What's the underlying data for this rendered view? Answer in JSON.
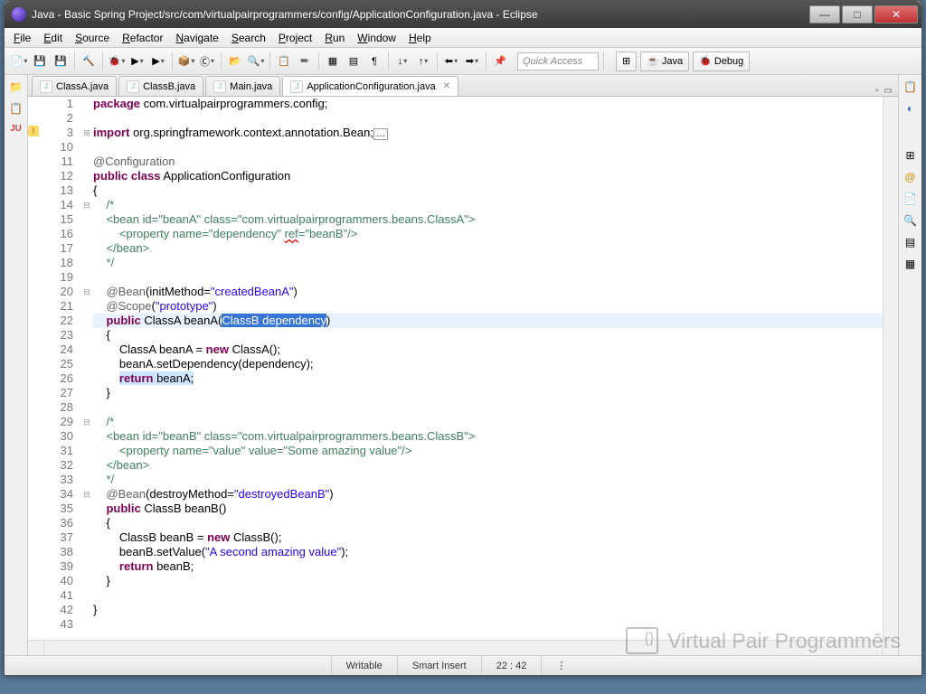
{
  "window": {
    "title": "Java - Basic Spring Project/src/com/virtualpairprogrammers/config/ApplicationConfiguration.java - Eclipse"
  },
  "menu": {
    "items": [
      "File",
      "Edit",
      "Source",
      "Refactor",
      "Navigate",
      "Search",
      "Project",
      "Run",
      "Window",
      "Help"
    ]
  },
  "toolbar": {
    "quick_access": "Quick Access",
    "perspectives": [
      {
        "label": "Java",
        "icon": "☕"
      },
      {
        "label": "Debug",
        "icon": "🐞"
      }
    ]
  },
  "tabs": [
    {
      "label": "ClassA.java",
      "active": false
    },
    {
      "label": "ClassB.java",
      "active": false
    },
    {
      "label": "Main.java",
      "active": false
    },
    {
      "label": "ApplicationConfiguration.java",
      "active": true
    }
  ],
  "code": {
    "lines": [
      {
        "n": 1,
        "html": "<span class='kw'>package</span> com.virtualpairprogrammers.config;"
      },
      {
        "n": 2,
        "html": ""
      },
      {
        "n": 3,
        "html": "<span class='kw'>import</span> org.springframework.context.annotation.Bean;<span style='border:1px solid #999;padding:0 2px;font-size:10px;'>…</span>",
        "fold": "+",
        "warn": true
      },
      {
        "n": 10,
        "html": ""
      },
      {
        "n": 11,
        "html": "<span class='ann'>@Configuration</span>"
      },
      {
        "n": 12,
        "html": "<span class='kw'>public</span> <span class='kw'>class</span> ApplicationConfiguration"
      },
      {
        "n": 13,
        "html": "{"
      },
      {
        "n": 14,
        "html": "    <span class='com'>/*</span>",
        "fold": "-"
      },
      {
        "n": 15,
        "html": "    <span class='com'>&lt;bean id=\"beanA\" class=\"com.virtualpairprogrammers.beans.ClassA\"&gt;</span>"
      },
      {
        "n": 16,
        "html": "        <span class='com'>&lt;property name=\"dependency\" <span style='text-decoration:underline wavy red;'>ref</span>=\"beanB\"/&gt;</span>"
      },
      {
        "n": 17,
        "html": "    <span class='com'>&lt;/bean&gt;</span>"
      },
      {
        "n": 18,
        "html": "    <span class='com'>*/</span>"
      },
      {
        "n": 19,
        "html": ""
      },
      {
        "n": 20,
        "html": "    <span class='ann'>@Bean</span>(initMethod=<span class='str'>\"createdBeanA\"</span>)",
        "fold": "-"
      },
      {
        "n": 21,
        "html": "    <span class='ann'>@Scope</span>(<span class='str'>\"prototype\"</span>)"
      },
      {
        "n": 22,
        "html": "    <span class='kw'>public</span> ClassA beanA(<span class='sel'>ClassB dependency</span>)",
        "current": true
      },
      {
        "n": 23,
        "html": "    {"
      },
      {
        "n": 24,
        "html": "        ClassA beanA = <span class='kw'>new</span> ClassA();"
      },
      {
        "n": 25,
        "html": "        beanA.setDependency(dependency);"
      },
      {
        "n": 26,
        "html": "        <span class='hl'><span class='kw'>return</span> beanA;</span>"
      },
      {
        "n": 27,
        "html": "    }"
      },
      {
        "n": 28,
        "html": ""
      },
      {
        "n": 29,
        "html": "    <span class='com'>/*</span>",
        "fold": "-"
      },
      {
        "n": 30,
        "html": "    <span class='com'>&lt;bean id=\"beanB\" class=\"com.virtualpairprogrammers.beans.ClassB\"&gt;</span>"
      },
      {
        "n": 31,
        "html": "        <span class='com'>&lt;property name=\"value\" value=\"Some amazing value\"/&gt;</span>"
      },
      {
        "n": 32,
        "html": "    <span class='com'>&lt;/bean&gt;</span>"
      },
      {
        "n": 33,
        "html": "    <span class='com'>*/</span>"
      },
      {
        "n": 34,
        "html": "    <span class='ann'>@Bean</span>(destroyMethod=<span class='str'>\"destroyedBeanB\"</span>)",
        "fold": "-"
      },
      {
        "n": 35,
        "html": "    <span class='kw'>public</span> ClassB beanB()"
      },
      {
        "n": 36,
        "html": "    {"
      },
      {
        "n": 37,
        "html": "        ClassB beanB = <span class='kw'>new</span> ClassB();"
      },
      {
        "n": 38,
        "html": "        beanB.setValue(<span class='str'>\"A second amazing value\"</span>);"
      },
      {
        "n": 39,
        "html": "        <span class='kw'>return</span> beanB;"
      },
      {
        "n": 40,
        "html": "    }"
      },
      {
        "n": 41,
        "html": ""
      },
      {
        "n": 42,
        "html": "}"
      },
      {
        "n": 43,
        "html": ""
      }
    ]
  },
  "status": {
    "writable": "Writable",
    "insert": "Smart Insert",
    "pos": "22 : 42"
  },
  "watermark": "Virtual Pair Programmērs"
}
